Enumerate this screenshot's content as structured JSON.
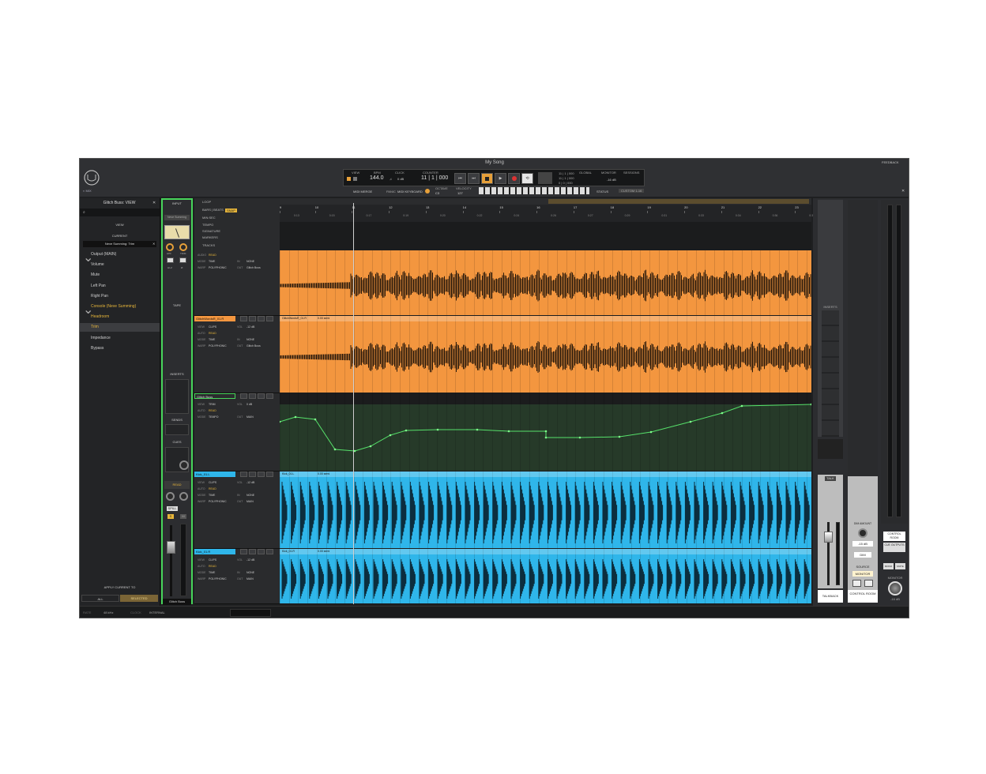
{
  "window": {
    "title": "My Song",
    "feedback_label": "FEEDBACK"
  },
  "transport": {
    "view_label": "VIEW",
    "bpm_label": "BPM",
    "bpm_value": "144.0",
    "click_label": "CLICK",
    "click_value": "0 dB",
    "counter_label": "COUNTER",
    "counter_value": "11 | 1 | 000",
    "global_label": "GLOBAL",
    "monitor_label": "MONITOR",
    "monitor_value": "-16 dB",
    "sessions_label": "SESSIONS",
    "counter_small": [
      "11 | 1 | 000",
      "11 | 1 | 000",
      "0 | 0 | 000"
    ]
  },
  "toolbar": {
    "midi_merge": "MIDI MERGE",
    "panic": "PANIC",
    "midi_keyboard": "MIDI KEYBOARD",
    "octave_label": "OCTAVE",
    "octave_value": "C3",
    "velocity_label": "VELOCITY",
    "velocity_value": "127",
    "status_label": "STATUS",
    "status_value": "CUSTOM 1-16"
  },
  "left_panel": {
    "title": "Glitch Buss: VIEW",
    "view_label": "VIEW",
    "current_label": "CURRENT",
    "current_value": "Neve Summing: Trim",
    "tree": [
      {
        "label": "Output (MAIN)",
        "level": 0,
        "state": "normal"
      },
      {
        "label": "Volume",
        "level": 1,
        "state": "normal"
      },
      {
        "label": "Mute",
        "level": 1,
        "state": "normal"
      },
      {
        "label": "Left Pan",
        "level": 1,
        "state": "normal"
      },
      {
        "label": "Right Pan",
        "level": 1,
        "state": "normal"
      },
      {
        "label": "Console (Neve Summing)",
        "level": 0,
        "state": "plugin"
      },
      {
        "label": "Headroom",
        "level": 1,
        "state": "plugin"
      },
      {
        "label": "Trim",
        "level": 1,
        "state": "selected"
      },
      {
        "label": "Impedance",
        "level": 1,
        "state": "normal"
      },
      {
        "label": "Bypass",
        "level": 1,
        "state": "normal"
      }
    ],
    "apply_label": "APPLY CURRENT TO",
    "all_label": "ALL",
    "selected_label": "SELECTED"
  },
  "channel_strip": {
    "input_label": "INPUT",
    "preset_label": "Neve Summing",
    "tape_label": "TAPE",
    "inserts_label": "INSERTS",
    "sends_label": "SENDS",
    "cues_label": "CUES",
    "read_label": "READ",
    "spill_label": "SPILL",
    "s_label": "S",
    "m_label": "M",
    "name": "Glitch Buss",
    "hpf_label": "HPF",
    "trim_label": "TRIM",
    "hi_label": "HI-Z",
    "ohm_label": "Ø"
  },
  "timeline": {
    "rows": [
      "LOOP",
      "BARS | BEATS",
      "MIN:SEC",
      "TEMPO",
      "SIGNATURE",
      "MARKERS",
      "TRACKS"
    ],
    "snap_label": "SNAP",
    "bars": [
      "9",
      "10",
      "11",
      "12",
      "13",
      "14",
      "15",
      "16",
      "17",
      "18",
      "19",
      "20",
      "21",
      "22",
      "23"
    ],
    "times": [
      "0:13",
      "0:15",
      "0:17",
      "0:19",
      "0:20",
      "0:22",
      "0:24",
      "0:26",
      "0:27",
      "0:29",
      "0:31",
      "0:33",
      "0:34",
      "0:36",
      "0:38"
    ]
  },
  "tracks": [
    {
      "name": "",
      "clip_name": "",
      "rows": [
        [
          "AUDIO",
          "READ",
          "",
          ""
        ],
        [
          "MODE",
          "TIME",
          "IN",
          "NONE"
        ],
        [
          "WARP",
          "POLYPHONIC",
          "OUT",
          "Glitch Buss"
        ]
      ]
    },
    {
      "name": "GlitchWordsR_01.R",
      "clip_name": "GlitchWordsR_01.R",
      "clip_offset": "0.00 semi",
      "rows": [
        [
          "VIEW",
          "CLIPS",
          "VOL",
          "-12 dB"
        ],
        [
          "AUTO",
          "READ",
          "",
          ""
        ],
        [
          "MODE",
          "TIME",
          "IN",
          "NONE"
        ],
        [
          "WARP",
          "POLYPHONIC",
          "OUT",
          "Glitch Buss"
        ]
      ]
    },
    {
      "name": "Glitch Buss",
      "clip_name": "",
      "rows": [
        [
          "VIEW",
          "TRIM",
          "VOL",
          "0 dB"
        ],
        [
          "AUTO",
          "READ",
          "",
          ""
        ],
        [
          "MODE",
          "TEMPO",
          "OUT",
          "MAIN"
        ]
      ],
      "spill_label": "SPILL"
    },
    {
      "name": "Kick_01.L",
      "clip_name": "Kick_01.L",
      "clip_offset": "0.00 semi",
      "rows": [
        [
          "VIEW",
          "CLIPS",
          "VOL",
          "-12 dB"
        ],
        [
          "AUTO",
          "READ",
          "",
          ""
        ],
        [
          "MODE",
          "TIME",
          "IN",
          "NONE"
        ],
        [
          "WARP",
          "POLYPHONIC",
          "OUT",
          "MAIN"
        ]
      ]
    },
    {
      "name": "Kick_01.R",
      "clip_name": "Kick_01.R",
      "clip_offset": "0.00 semi",
      "rows": [
        [
          "VIEW",
          "CLIPS",
          "VOL",
          "-12 dB"
        ],
        [
          "AUTO",
          "READ",
          "",
          ""
        ],
        [
          "MODE",
          "TIME",
          "IN",
          "NONE"
        ],
        [
          "WARP",
          "POLYPHONIC",
          "OUT",
          "MAIN"
        ]
      ]
    }
  ],
  "right_panel": {
    "inserts_label": "INSERTS",
    "sends_label": "SENDS",
    "talk_label": "TALK",
    "talkback_label": "TALKBACK",
    "dim_amount_label": "DIM AMOUNT",
    "dim_value": "-15 dB",
    "dim_label": "DIM",
    "source_label": "SOURCE",
    "monitor_label": "MONITOR",
    "control_room_label": "CONTROL ROOM",
    "cue_outputs_label": "CUE OUTPUTS",
    "mono_label": "MONO",
    "mute_label": "MUTE",
    "monitor_knob_label": "MONITOR",
    "monitor_knob_value": "-16 dB"
  },
  "status_bar": {
    "rate_label": "RATE",
    "rate_value": "48 kHz",
    "clock_label": "CLOCK",
    "clock_value": "INTERNAL"
  },
  "colors": {
    "orange": "#f3963f",
    "blue": "#2fb6ea",
    "green": "#47d45a",
    "accent_yellow": "#e6b53a"
  }
}
